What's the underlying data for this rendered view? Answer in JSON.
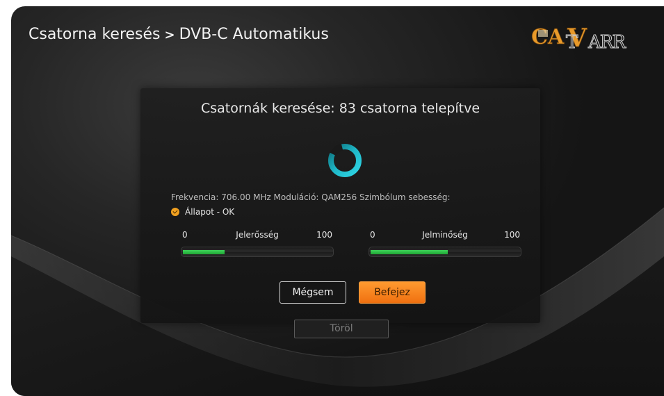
{
  "header": {
    "section": "Csatorna keresés",
    "separator": ">",
    "subsection": "DVB-C Automatikus"
  },
  "logo": {
    "text": "CATV ARR"
  },
  "dialog": {
    "title": "Csatornák keresése: 83 csatorna telepítve",
    "info": "Frekvencia: 706.00 MHz Moduláció: QAM256 Szimbólum sebesség:",
    "status": "Állapot - OK",
    "signal": {
      "min": "0",
      "label": "Jelerősség",
      "max": "100",
      "level": 28
    },
    "quality": {
      "min": "0",
      "label": "Jelminőség",
      "max": "100",
      "level": 52
    },
    "cancel_label": "Mégsem",
    "finish_label": "Befejez"
  },
  "footer": {
    "delete_label": "Töröl"
  },
  "colors": {
    "accent": "#f07d1a",
    "spinner": "#1fb8c8",
    "meter_fill": "#2ec248",
    "status": "#f0a020"
  },
  "icons": {
    "spinner": "loading-spinner-icon",
    "status": "checkmark-circle-icon"
  }
}
